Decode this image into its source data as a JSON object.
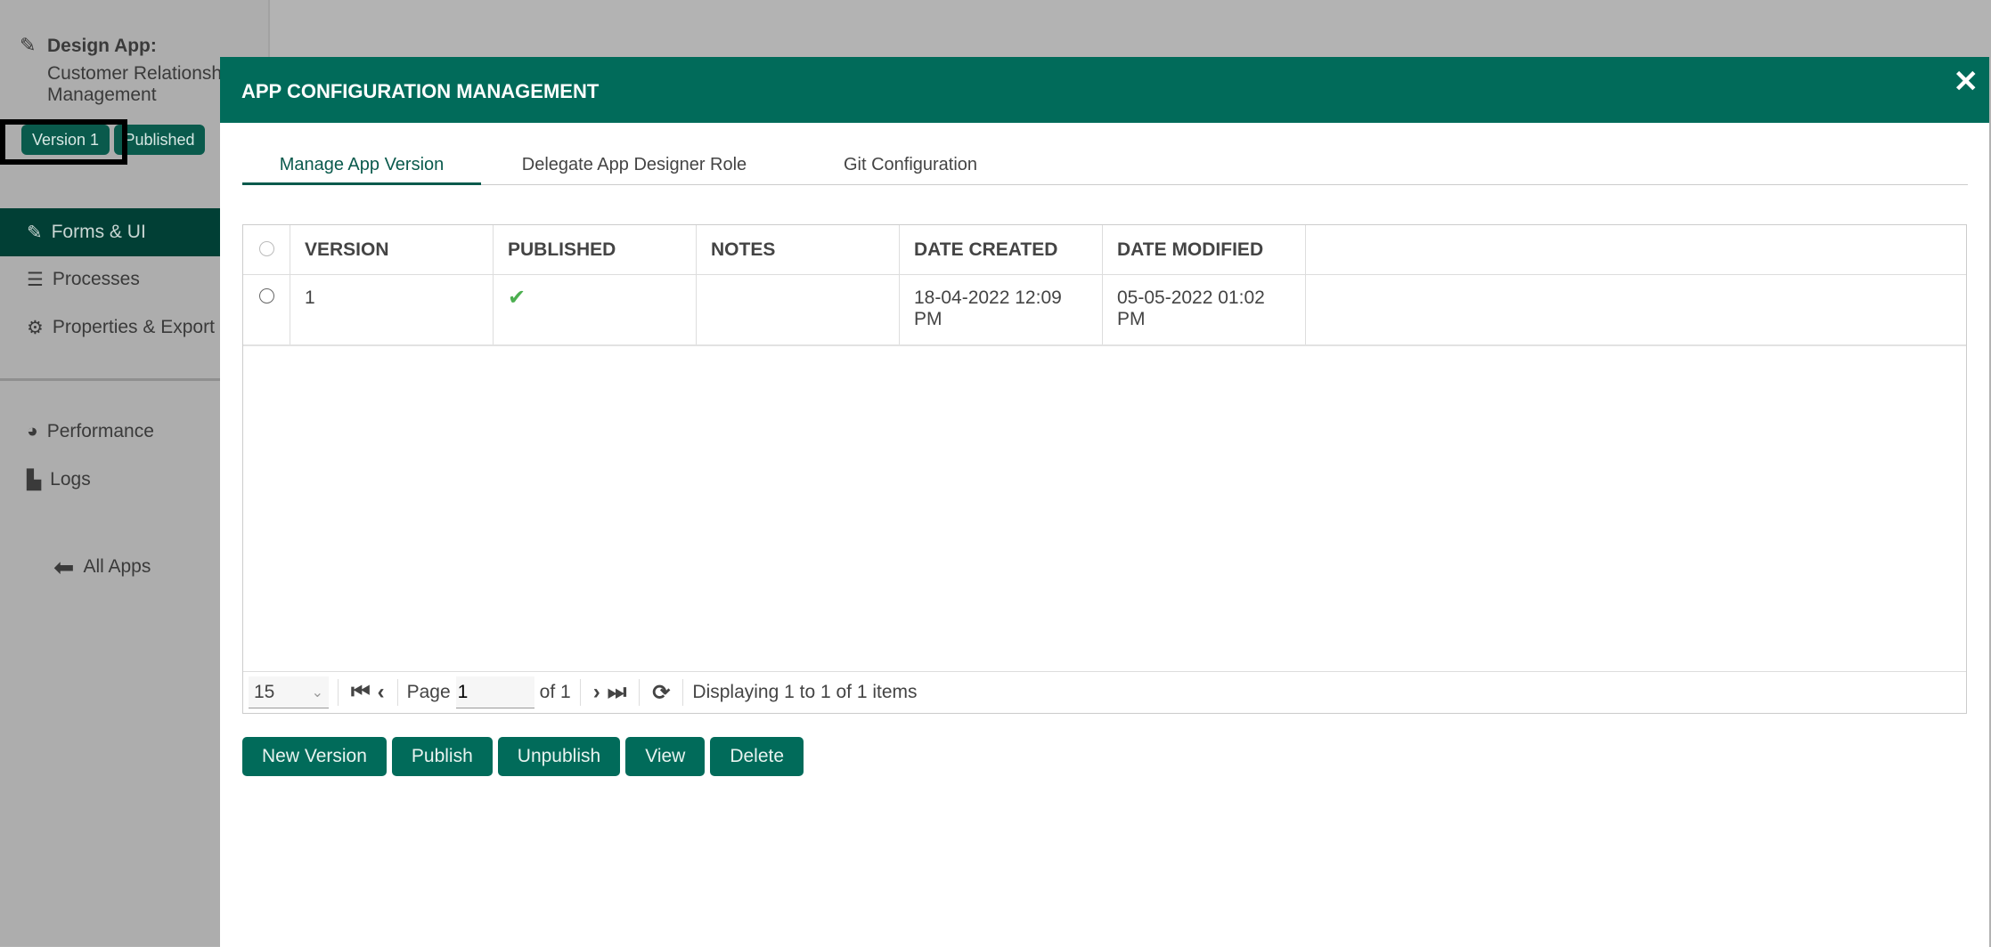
{
  "sidebar": {
    "design_label": "Design App:",
    "app_name_line1": "Customer Relationship",
    "app_name_line2": "Management",
    "version_badge": "Version 1",
    "status_badge": "Published",
    "nav": [
      {
        "label": "Forms & UI",
        "icon": "edit-icon",
        "active": true
      },
      {
        "label": "Processes",
        "icon": "list-icon"
      },
      {
        "label": "Properties & Export",
        "icon": "gear-icon"
      },
      {
        "label": "Performance",
        "icon": "gauge-icon"
      },
      {
        "label": "Logs",
        "icon": "scroll-icon"
      }
    ],
    "all_apps": "All Apps"
  },
  "modal": {
    "title": "APP CONFIGURATION MANAGEMENT",
    "close": "✕",
    "tabs": [
      {
        "label": "Manage App Version"
      },
      {
        "label": "Delegate App Designer Role"
      },
      {
        "label": "Git Configuration"
      }
    ],
    "table": {
      "columns": [
        "VERSION",
        "PUBLISHED",
        "NOTES",
        "DATE CREATED",
        "DATE MODIFIED"
      ],
      "rows": [
        {
          "version": "1",
          "published": "✔",
          "notes": "",
          "date_created": "18-04-2022 12:09 PM",
          "date_modified": "05-05-2022 01:02 PM"
        }
      ]
    },
    "pager": {
      "page_size": "15",
      "page_label": "Page",
      "page": "1",
      "of_label": "of 1",
      "display": "Displaying 1 to 1 of 1 items"
    },
    "buttons": [
      "New Version",
      "Publish",
      "Unpublish",
      "View",
      "Delete"
    ]
  },
  "colors": {
    "accent": "#016b5a",
    "nav_active": "#013f35"
  }
}
